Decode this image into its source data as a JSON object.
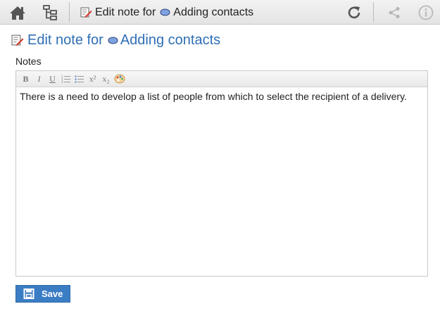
{
  "topbar": {
    "icons": {
      "home": "home-icon",
      "hierarchy": "hierarchy-icon",
      "refresh": "refresh-icon",
      "share": "share-icon",
      "info": "info-icon"
    },
    "title_prefix": "Edit note for",
    "title_element": "Adding contacts"
  },
  "heading": {
    "prefix": "Edit note for",
    "element": "Adding contacts"
  },
  "notes": {
    "label": "Notes",
    "toolbar": [
      {
        "name": "bold",
        "glyph": "B"
      },
      {
        "name": "italic",
        "glyph": "I"
      },
      {
        "name": "underline",
        "glyph": "U"
      },
      {
        "name": "ordered-list",
        "glyph": ""
      },
      {
        "name": "bullet-list",
        "glyph": ""
      },
      {
        "name": "superscript",
        "glyph": "x²"
      },
      {
        "name": "subscript",
        "glyph": "x₂"
      },
      {
        "name": "color",
        "glyph": ""
      }
    ],
    "content": "There is a need to develop a list of people from which to select the recipient of a delivery."
  },
  "save": {
    "label": "Save"
  },
  "colors": {
    "accent": "#2f6fb5",
    "button": "#3b7dc4",
    "ellipse_fill": "#7fa3e0"
  }
}
